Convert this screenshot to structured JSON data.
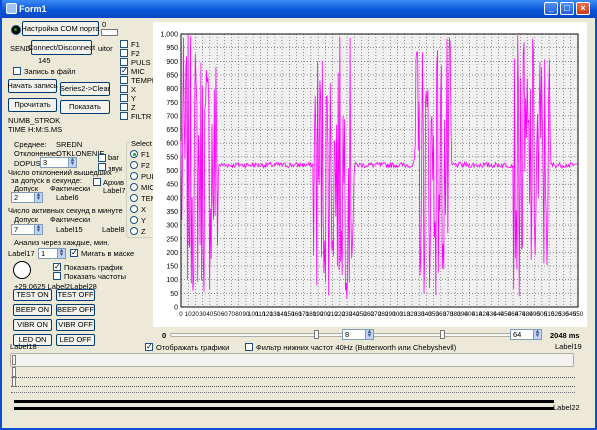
{
  "window": {
    "title": "Form1"
  },
  "top": {
    "com_label": "Настройка СОМ порта",
    "zero": "0",
    "send": "SEND",
    "connect": "Connect/Disconnect",
    "uitor": "uitor",
    "count": "145",
    "record_to_file": "Запись в файл"
  },
  "buttons": {
    "start_record": "Начать запись",
    "series_clear": "Series2->Clear",
    "read": "Прочитать",
    "show": "Показать"
  },
  "labels": {
    "numb_strok": "NUMB_STROK",
    "time": "TIME H:M:S.MS",
    "sred_label": "Среднее:",
    "sred_value": "SREDN",
    "otkl_label": "Отклонение:",
    "otkl_value": "OTKLONENIE",
    "dopusk": "DOPUSK",
    "bar": "bar",
    "zvuk": "звук",
    "count_dev_1": "Число отклонений вышедших",
    "count_dev_2": "за допуск в секунде:",
    "arhiv": "Архив",
    "dopusk2": "Допуск",
    "fakt": "Фактически",
    "label6": "Label6",
    "label7": "Label7",
    "count_active": "Число активных секунд в минуте",
    "dopusk3": "Допуск",
    "fakt2": "Фактически",
    "label15": "Label15",
    "label8": "Label8",
    "analiz": "Анализ через каждые, мин.",
    "label17": "Label17",
    "blink": "Мигать в маске",
    "show_graph": "Показать график",
    "show_freq": "Показать частоты",
    "label28": "+29.0625 Label2Label28",
    "label18": "Label18",
    "label19": "Label19",
    "label22": "Label22"
  },
  "spins": {
    "dopusk": "3",
    "dopusk2": "2",
    "dopusk3": "7",
    "analiz": "1",
    "bottom_left": "8",
    "bottom_right": "64"
  },
  "channels": [
    "F1",
    "F2",
    "PULS",
    "MIC",
    "TEMPER",
    "X",
    "Y",
    "Z",
    "FILTR"
  ],
  "channels_checked": [
    "MIC"
  ],
  "select": {
    "title": "Select",
    "options": [
      "F1",
      "F2",
      "PULS",
      "MIC",
      "TEMP",
      "X",
      "Y",
      "Z"
    ],
    "selected": "F1"
  },
  "test_buttons": [
    "TEST ON",
    "TEST OFF",
    "BEEP ON",
    "BEEP OFF",
    "VIBR ON",
    "VIBR OFF",
    "LED ON",
    "LED OFF"
  ],
  "bottom": {
    "left_value": "0",
    "right_value": "2048 ms",
    "show_graphs": "Отображать графики",
    "filter": "Фильтр нижних частот 40Hz (Butterworth или Chebyshevll)"
  },
  "chart_data": {
    "type": "line",
    "title": "",
    "xlabel": "",
    "ylabel": "",
    "xlim": [
      0,
      550
    ],
    "ylim": [
      0,
      1000
    ],
    "x_ticks": [
      "0",
      "10",
      "20",
      "30",
      "40",
      "50",
      "60",
      "70",
      "80",
      "90",
      "100",
      "110",
      "120",
      "130",
      "140",
      "150",
      "160",
      "170",
      "180",
      "190",
      "200",
      "210",
      "220",
      "230",
      "240",
      "250",
      "260",
      "270",
      "280",
      "290",
      "300",
      "310",
      "320",
      "330",
      "340",
      "350",
      "360",
      "370",
      "380",
      "390",
      "400",
      "410",
      "420",
      "430",
      "440",
      "450",
      "460",
      "470",
      "480",
      "490",
      "500",
      "510",
      "520",
      "530",
      "540",
      "550"
    ],
    "y_ticks": [
      "0",
      "50",
      "100",
      "150",
      "200",
      "250",
      "300",
      "350",
      "400",
      "450",
      "500",
      "550",
      "600",
      "650",
      "700",
      "750",
      "800",
      "850",
      "900",
      "950",
      "1,000"
    ],
    "series": [
      {
        "color": "#ff00ff",
        "baseline": 520,
        "bursts": [
          [
            0,
            52
          ],
          [
            183,
            240
          ],
          [
            323,
            375
          ],
          [
            460,
            512
          ]
        ],
        "burst_range": [
          30,
          1000
        ]
      }
    ],
    "grid": true,
    "background": "#f0f0f0"
  }
}
